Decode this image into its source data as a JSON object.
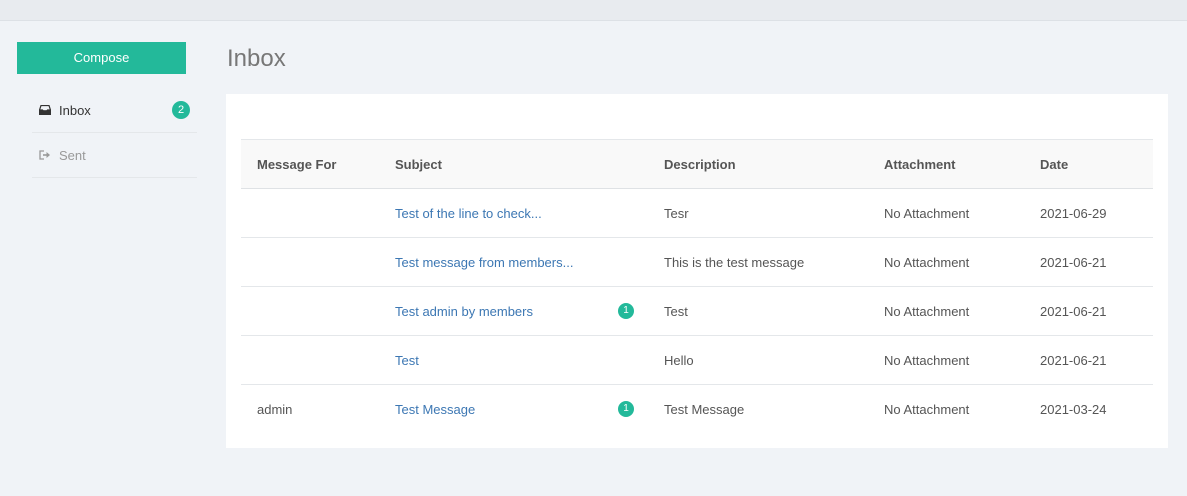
{
  "colors": {
    "accent": "#23b99a",
    "link": "#3c77b3",
    "background": "#f0f3f7"
  },
  "sidebar": {
    "compose_label": "Compose",
    "items": [
      {
        "icon": "inbox-icon",
        "label": "Inbox",
        "badge": "2"
      },
      {
        "icon": "sign-out-icon",
        "label": "Sent"
      }
    ]
  },
  "main": {
    "title": "Inbox",
    "table": {
      "headers": [
        "Message For",
        "Subject",
        "Description",
        "Attachment",
        "Date"
      ],
      "rows": [
        {
          "for": "",
          "subject": "Test of the line to check...",
          "badge": "",
          "description": "Tesr",
          "attachment": "No Attachment",
          "date": "2021-06-29"
        },
        {
          "for": "",
          "subject": "Test message from members...",
          "badge": "",
          "description": "This is the test message",
          "attachment": "No Attachment",
          "date": "2021-06-21"
        },
        {
          "for": "",
          "subject": "Test admin by members",
          "badge": "1",
          "description": "Test",
          "attachment": "No Attachment",
          "date": "2021-06-21"
        },
        {
          "for": "",
          "subject": "Test",
          "badge": "",
          "description": "Hello",
          "attachment": "No Attachment",
          "date": "2021-06-21"
        },
        {
          "for": "admin",
          "subject": "Test Message",
          "badge": "1",
          "description": "Test Message",
          "attachment": "No Attachment",
          "date": "2021-03-24"
        }
      ]
    }
  }
}
